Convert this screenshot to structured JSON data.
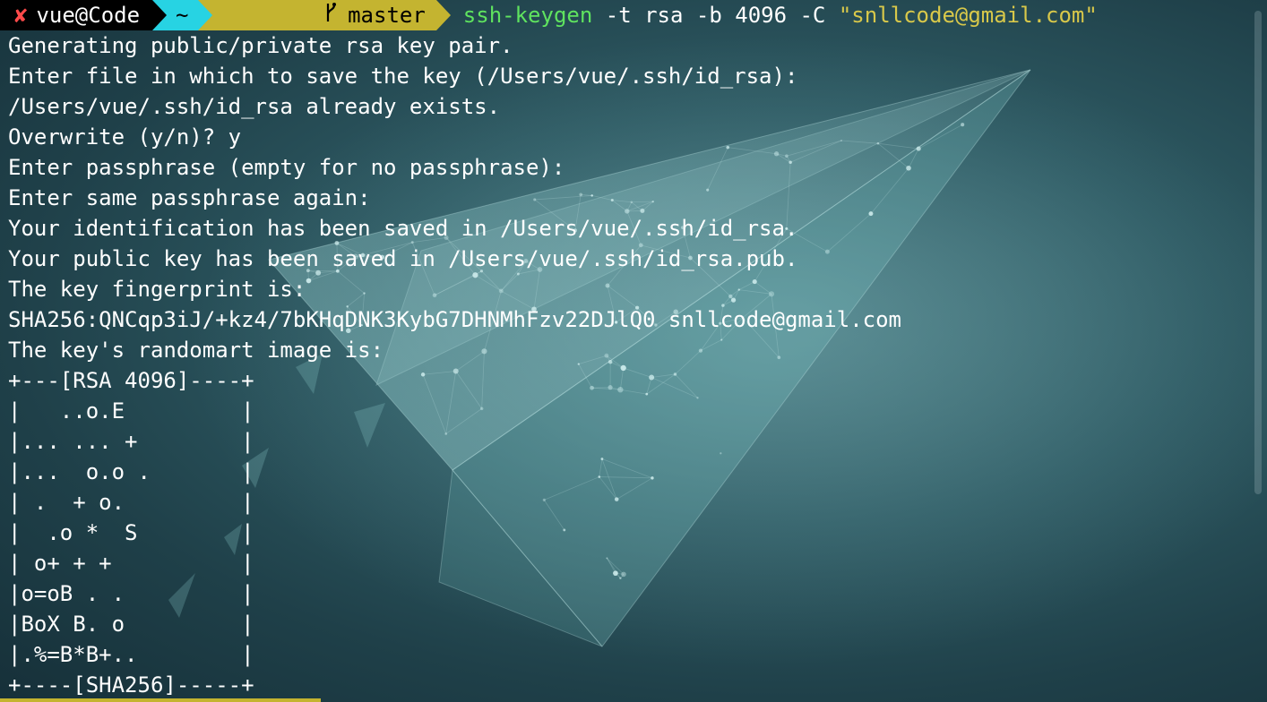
{
  "prompt": {
    "status_icon": "✘",
    "user_host": "vue@Code",
    "directory": "~",
    "branch_icon": "git-branch-icon",
    "branch": "master",
    "command_name": "ssh-keygen",
    "command_args": " -t rsa -b 4096 -C ",
    "command_string": "\"snllcode@gmail.com\""
  },
  "output_lines": [
    "Generating public/private rsa key pair.",
    "Enter file in which to save the key (/Users/vue/.ssh/id_rsa):",
    "/Users/vue/.ssh/id_rsa already exists.",
    "Overwrite (y/n)? y",
    "Enter passphrase (empty for no passphrase):",
    "Enter same passphrase again:",
    "Your identification has been saved in /Users/vue/.ssh/id_rsa.",
    "Your public key has been saved in /Users/vue/.ssh/id_rsa.pub.",
    "The key fingerprint is:",
    "SHA256:QNCqp3iJ/+kz4/7bKHqDNK3KybG7DHNMhFzv22DJlQ0 snllcode@gmail.com",
    "The key's randomart image is:",
    "+---[RSA 4096]----+",
    "|   ..o.E         |",
    "|... ... +        |",
    "|...  o.o .       |",
    "| .  + o.         |",
    "|  .o *  S        |",
    "| o+ + +          |",
    "|o=oB . .         |",
    "|BoX B. o         |",
    "|.%=B*B+..        |",
    "+----[SHA256]-----+"
  ],
  "colors": {
    "status_icon": "#ff4a4a",
    "segment_user": "#000000",
    "segment_dir": "#27d3e3",
    "segment_git": "#c4b430",
    "command": "#5fe35f",
    "string": "#d8c84a"
  }
}
